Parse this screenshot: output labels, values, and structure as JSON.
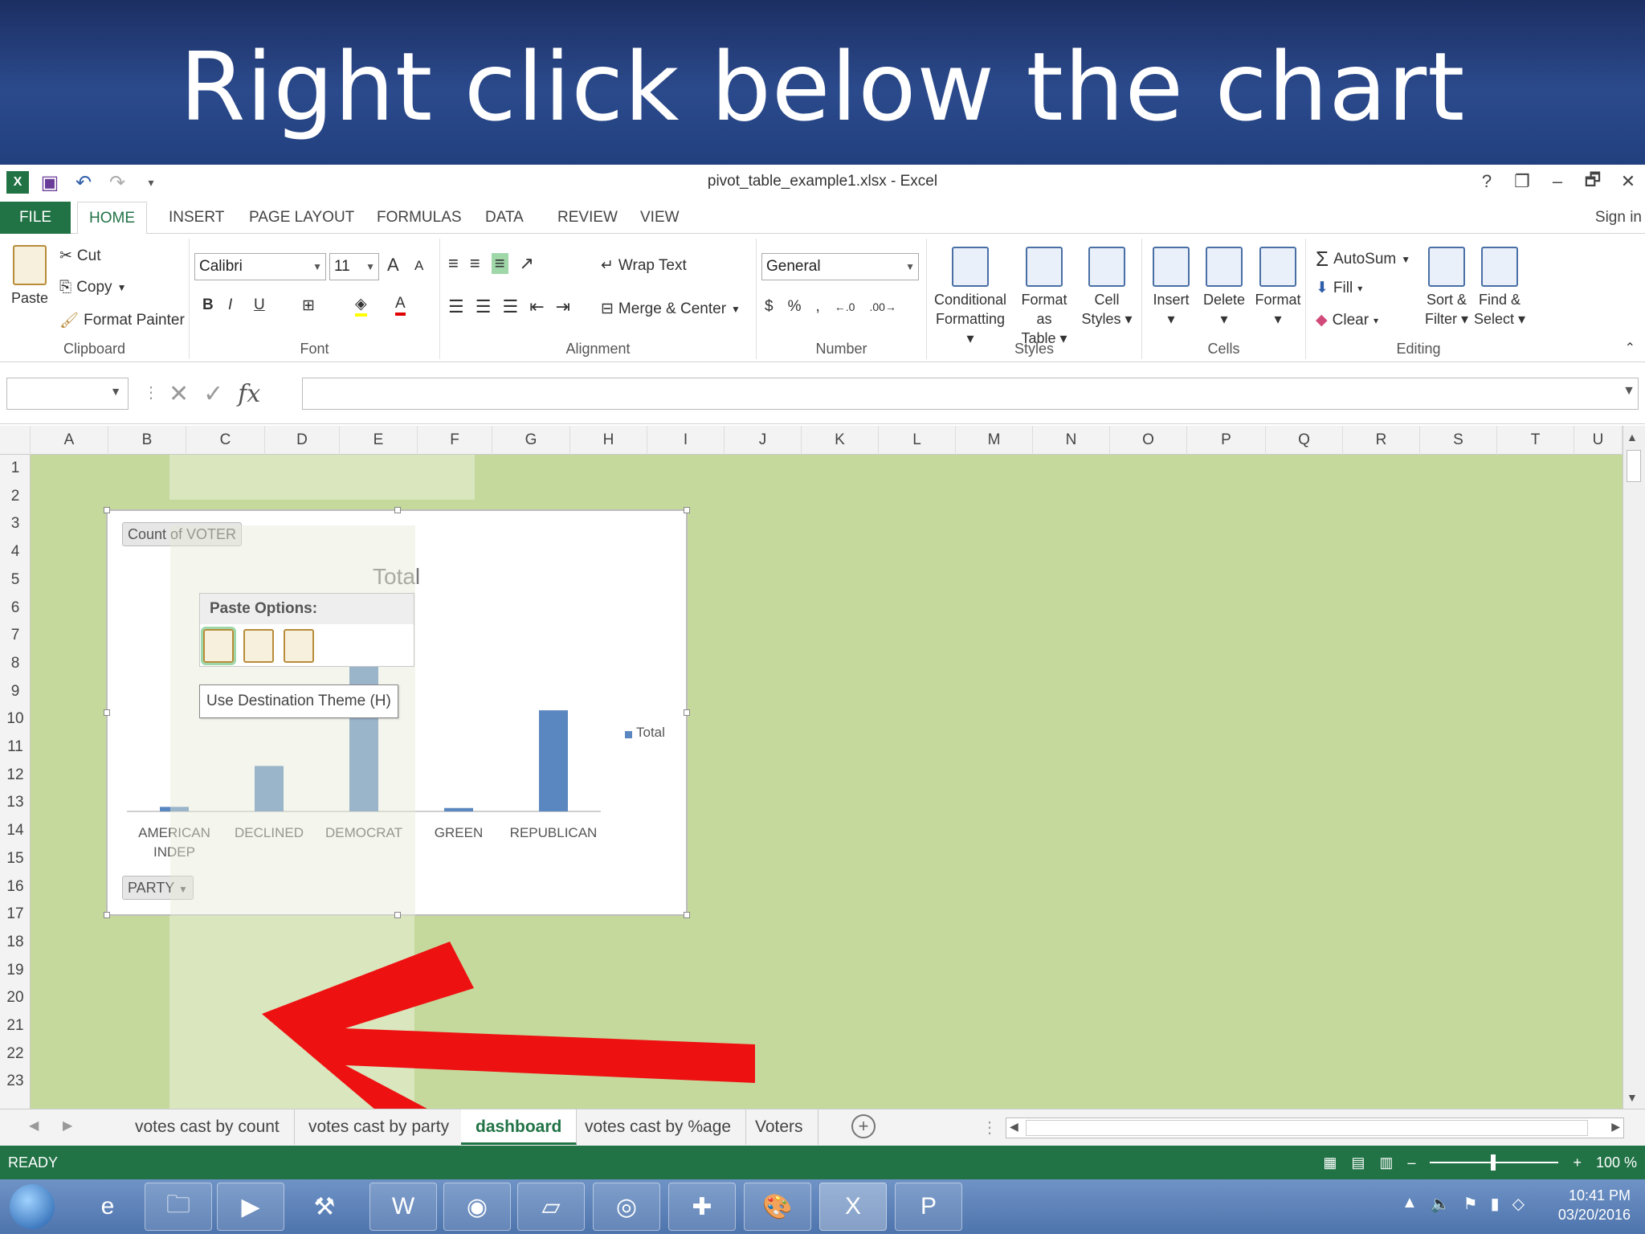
{
  "banner": {
    "text": "Right click below the chart"
  },
  "window": {
    "title": "pivot_table_example1.xlsx - Excel",
    "help": "?",
    "restore": "❐",
    "minimize": "–",
    "maximize": "🗗",
    "close": "✕"
  },
  "qat": {
    "save_icon": "save-icon",
    "undo": "↶",
    "redo": "↷",
    "customize": "▾"
  },
  "tabs": {
    "file": "FILE",
    "home": "HOME",
    "insert": "INSERT",
    "page_layout": "PAGE LAYOUT",
    "formulas": "FORMULAS",
    "data": "DATA",
    "review": "REVIEW",
    "view": "VIEW",
    "sign_in": "Sign in"
  },
  "ribbon": {
    "clipboard": {
      "label": "Clipboard",
      "paste": "Paste",
      "cut": "Cut",
      "copy": "Copy",
      "format_painter": "Format Painter"
    },
    "font": {
      "label": "Font",
      "name": "Calibri",
      "size": "11",
      "bold": "B",
      "italic": "I",
      "underline": "U",
      "grow": "A",
      "shrink": "A"
    },
    "alignment": {
      "label": "Alignment",
      "wrap_text": "Wrap Text",
      "merge_center": "Merge & Center"
    },
    "number": {
      "label": "Number",
      "format": "General",
      "percent": "%",
      "comma": ","
    },
    "styles": {
      "label": "Styles",
      "conditional": "Conditional",
      "conditional2": "Formatting",
      "format_as": "Format as",
      "format_as2": "Table",
      "cell": "Cell",
      "cell2": "Styles"
    },
    "cells": {
      "label": "Cells",
      "insert": "Insert",
      "delete": "Delete",
      "format": "Format"
    },
    "editing": {
      "label": "Editing",
      "autosum": "AutoSum",
      "fill": "Fill",
      "clear": "Clear",
      "sort": "Sort &",
      "sort2": "Filter",
      "find": "Find &",
      "find2": "Select"
    }
  },
  "formula_bar": {
    "cancel": "✕",
    "enter": "✓",
    "fx": "fx",
    "value": ""
  },
  "columns": [
    "A",
    "B",
    "C",
    "D",
    "E",
    "F",
    "G",
    "H",
    "I",
    "J",
    "K",
    "L",
    "M",
    "N",
    "O",
    "P",
    "Q",
    "R",
    "S",
    "T",
    "U"
  ],
  "rows": [
    "1",
    "2",
    "3",
    "4",
    "5",
    "6",
    "7",
    "8",
    "9",
    "10",
    "11",
    "12",
    "13",
    "14",
    "15",
    "16",
    "17",
    "18",
    "19",
    "20",
    "21",
    "22",
    "23"
  ],
  "chart": {
    "count_button": "Count of VOTER",
    "party_button": "PARTY",
    "legend": "Total"
  },
  "chart_data": {
    "type": "bar",
    "title": "Total",
    "categories": [
      "AMERICAN INDEP",
      "DECLINED",
      "DEMOCRAT",
      "GREEN",
      "REPUBLICAN"
    ],
    "series": [
      {
        "name": "Total",
        "values": [
          4,
          40,
          137,
          3,
          89
        ]
      }
    ],
    "ylim": [
      0,
      140
    ],
    "grid": false,
    "legend_position": "right",
    "bar_color": "#5b87c0"
  },
  "paste_options": {
    "title": "Paste Options:",
    "tooltip": "Use Destination Theme (H)"
  },
  "sheet_tabs": [
    "votes cast by count",
    "votes cast by party",
    "dashboard",
    "votes cast by %age",
    "Voters"
  ],
  "status": {
    "ready": "READY",
    "zoom": "100 %"
  },
  "taskbar": {
    "time": "10:41 PM",
    "date": "03/20/2016"
  }
}
